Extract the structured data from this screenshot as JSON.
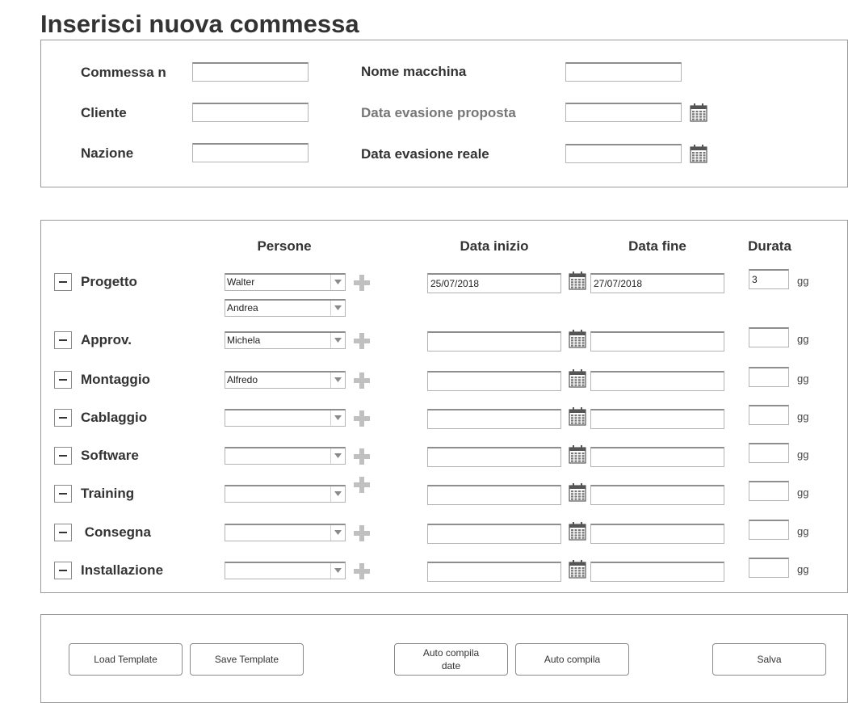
{
  "page_title": "Inserisci nuova commessa",
  "header_form": {
    "commessa_label": "Commessa n",
    "cliente_label": "Cliente",
    "nazione_label": "Nazione",
    "nome_macchina_label": "Nome macchina",
    "data_proposta_label": "Data evasione proposta",
    "data_reale_label": "Data evasione reale",
    "commessa_value": "",
    "cliente_value": "",
    "nazione_value": "",
    "nome_macchina_value": "",
    "data_proposta_value": "",
    "data_reale_value": ""
  },
  "phases_table": {
    "headers": {
      "persone": "Persone",
      "data_inizio": "Data inizio",
      "data_fine": "Data fine",
      "durata": "Durata"
    },
    "unit": "gg",
    "rows": [
      {
        "name": "Progetto",
        "people": [
          "Walter",
          "Andrea"
        ],
        "start": "25/07/2018",
        "end": "27/07/2018",
        "duration": "3"
      },
      {
        "name": "Approv.",
        "people": [
          "Michela"
        ],
        "start": "",
        "end": "",
        "duration": ""
      },
      {
        "name": "Montaggio",
        "people": [
          "Alfredo"
        ],
        "start": "",
        "end": "",
        "duration": ""
      },
      {
        "name": "Cablaggio",
        "people": [
          ""
        ],
        "start": "",
        "end": "",
        "duration": ""
      },
      {
        "name": "Software",
        "people": [
          ""
        ],
        "start": "",
        "end": "",
        "duration": ""
      },
      {
        "name": "Training",
        "people": [
          ""
        ],
        "start": "",
        "end": "",
        "duration": ""
      },
      {
        "name": " Consegna",
        "people": [
          ""
        ],
        "start": "",
        "end": "",
        "duration": ""
      },
      {
        "name": "Installazione",
        "people": [
          ""
        ],
        "start": "",
        "end": "",
        "duration": ""
      }
    ]
  },
  "buttons": {
    "load_template": "Load Template",
    "save_template": "Save Template",
    "auto_compila_date": "Auto compila\ndate",
    "auto_compila": "Auto compila",
    "salva": "Salva"
  },
  "icons": {
    "calendar": "calendar-icon",
    "add": "plus-icon",
    "remove": "minus-icon",
    "dropdown": "chevron-down-icon"
  },
  "colors": {
    "border": "#9a9a9a",
    "text": "#333333",
    "muted_label": "#777777",
    "plus_icon": "#c0c0c0"
  }
}
